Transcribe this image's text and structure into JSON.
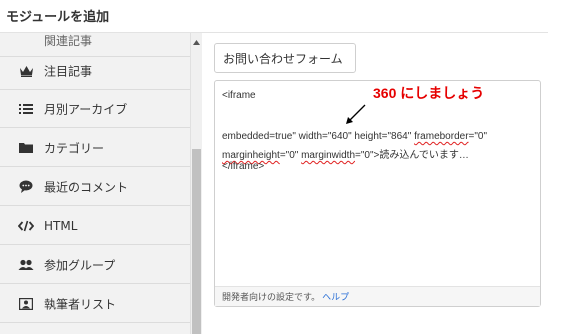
{
  "dialog": {
    "title": "モジュールを追加"
  },
  "menu": {
    "items": [
      {
        "label": "関連記事",
        "icon": "related-articles-icon"
      },
      {
        "label": "注目記事",
        "icon": "crown-icon"
      },
      {
        "label": "月別アーカイブ",
        "icon": "list-icon"
      },
      {
        "label": "カテゴリー",
        "icon": "folder-icon"
      },
      {
        "label": "最近のコメント",
        "icon": "comment-bubble-icon"
      },
      {
        "label": "HTML",
        "icon": "code-icon"
      },
      {
        "label": "参加グループ",
        "icon": "group-icon"
      },
      {
        "label": "執筆者リスト",
        "icon": "author-list-icon"
      }
    ]
  },
  "module": {
    "name_value": "お問い合わせフォーム",
    "code": {
      "line1": "<iframe",
      "line2_a": "embedded=true\" width=\"640\" height=\"864\" ",
      "line2_b": "frameborder",
      "line2_c": "=\"0\"",
      "line3_a": "marginheight",
      "line3_b": "=\"0\" ",
      "line3_c": "marginwidth",
      "line3_d": "=\"0\">読み込んでいます…",
      "line4": "</iframe>"
    },
    "annotation": "360 にしましょう",
    "footer_text": "開発者向けの設定です。",
    "footer_link": "ヘルプ"
  },
  "colors": {
    "annotation": "#e60000",
    "link": "#2a6fd6",
    "menu_bg": "#f2f2f2"
  }
}
